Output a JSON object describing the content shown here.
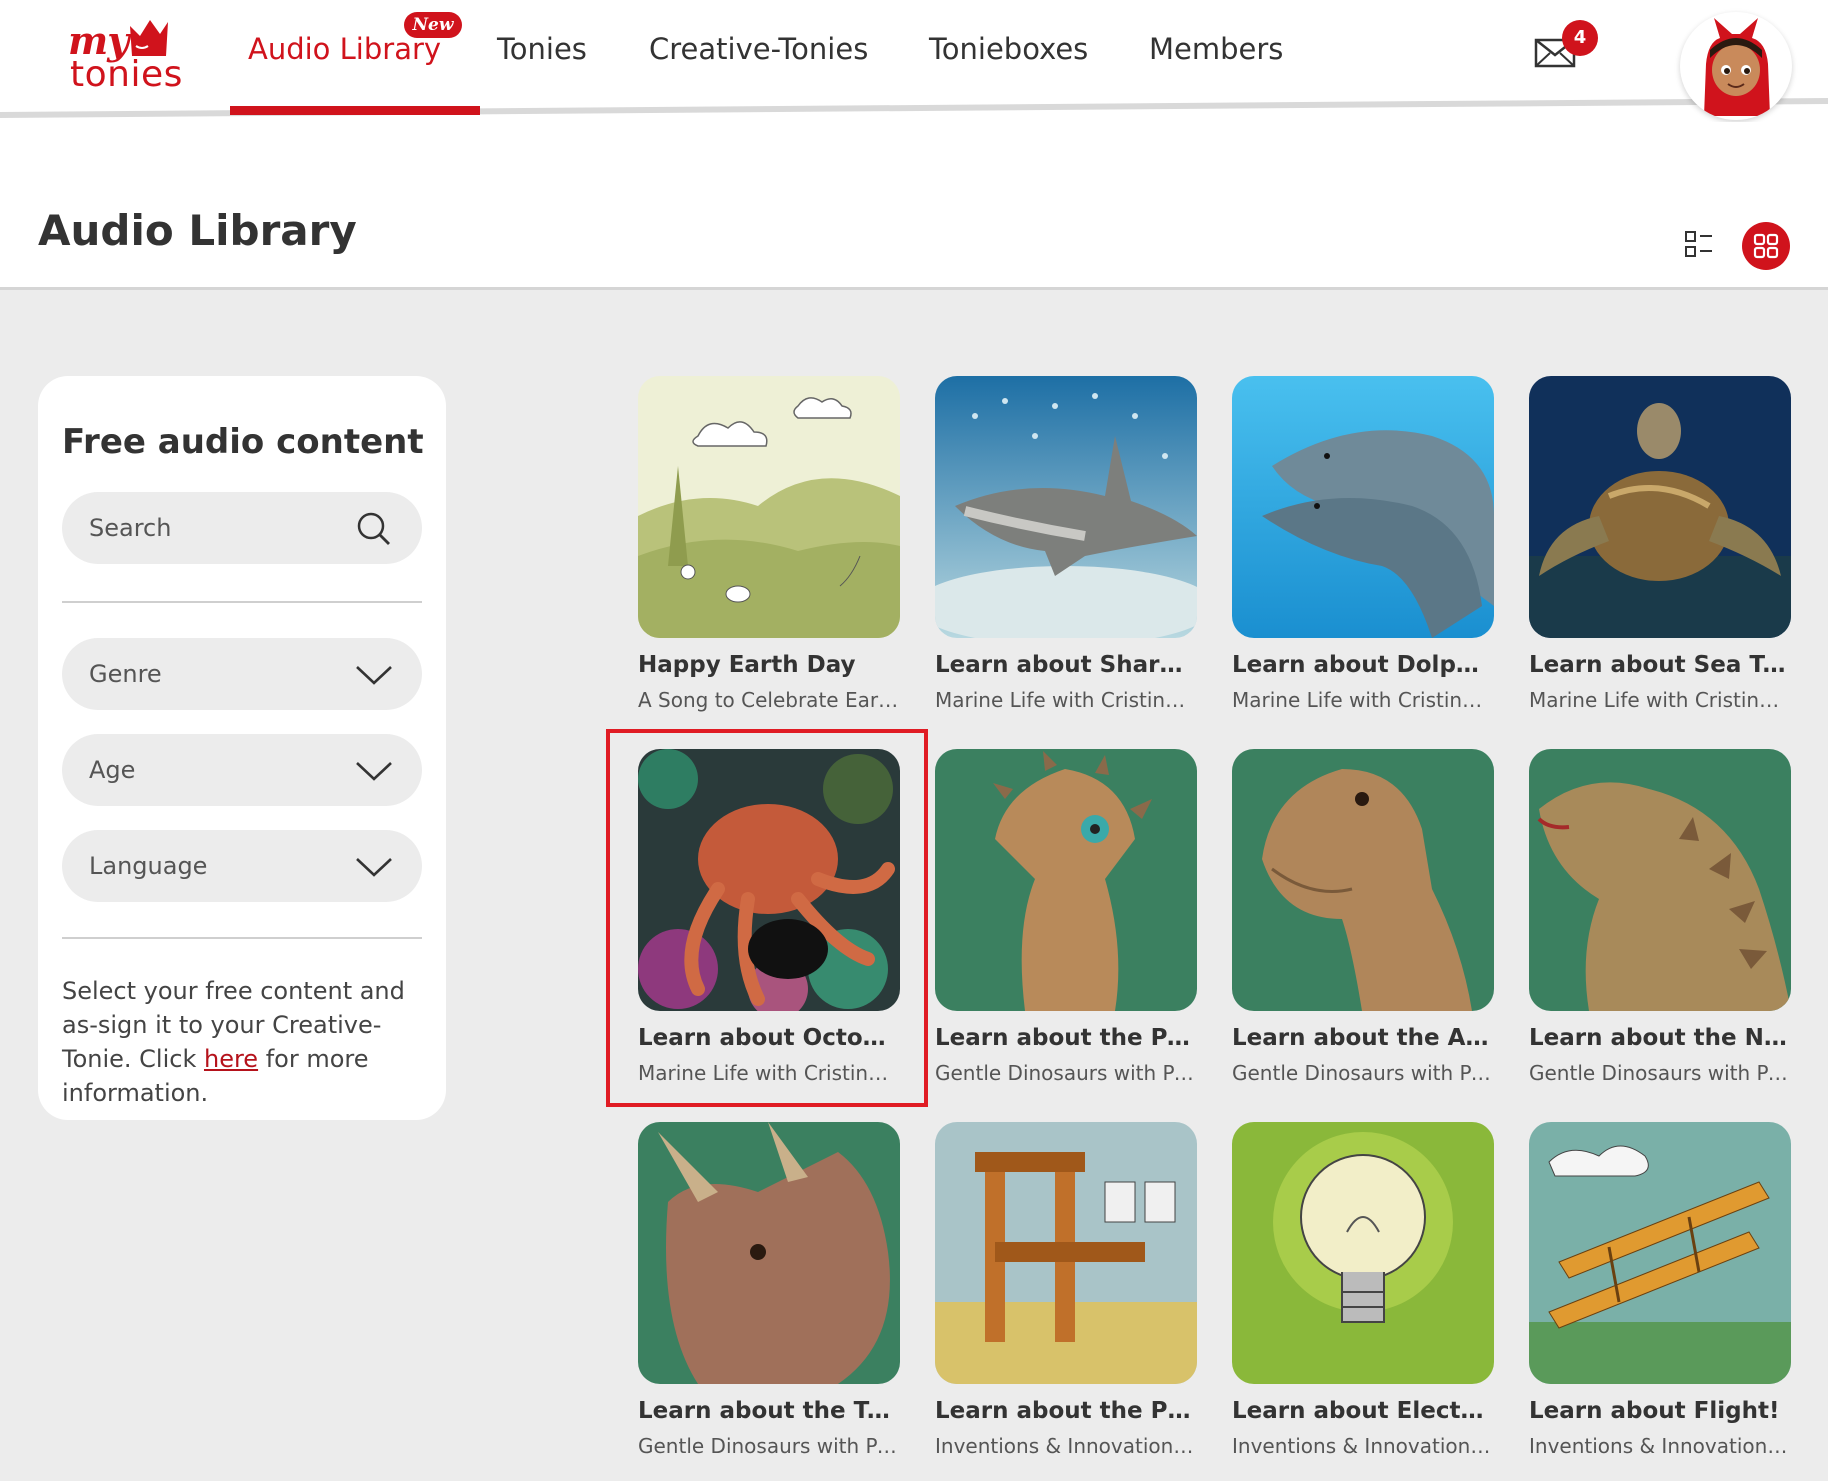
{
  "nav": {
    "logo_my": "my",
    "logo_tonies": "tonies",
    "new_badge": "New",
    "items": [
      {
        "label": "Audio Library",
        "active": true
      },
      {
        "label": "Tonies",
        "active": false
      },
      {
        "label": "Creative-Tonies",
        "active": false
      },
      {
        "label": "Tonieboxes",
        "active": false
      },
      {
        "label": "Members",
        "active": false
      }
    ],
    "mail_icon": "envelope-icon",
    "mail_count": "4",
    "avatar_icon": "red-cat-avatar-icon"
  },
  "page": {
    "title": "Audio Library",
    "view_list_icon": "list-view-icon",
    "view_grid_icon": "grid-view-icon"
  },
  "sidebar": {
    "title": "Free audio content",
    "search_placeholder": "Search",
    "search_icon": "search-icon",
    "filters": [
      {
        "label": "Genre"
      },
      {
        "label": "Age"
      },
      {
        "label": "Language"
      }
    ],
    "chevron_icon": "chevron-down-icon",
    "info_before": "Select your free content and as-sign it to your Creative-Tonie. Click ",
    "info_link": "here",
    "info_after": " for more information."
  },
  "cards": [
    {
      "title": "Happy Earth Day",
      "subtitle": "A Song to Celebrate Earth Day",
      "image": "earth-day-meadow-illustration"
    },
    {
      "title": "Learn about Sharks!",
      "subtitle": "Marine Life with Cristina Zenato",
      "image": "shark-underwater-photo"
    },
    {
      "title": "Learn about Dolphins!",
      "subtitle": "Marine Life with Cristina Zenato",
      "image": "dolphins-photo"
    },
    {
      "title": "Learn about Sea Turtles!",
      "subtitle": "Marine Life with Cristina Zenato",
      "image": "sea-turtle-photo"
    },
    {
      "title": "Learn about Octopus!",
      "subtitle": "Marine Life with Cristina Zenato",
      "image": "octopus-photo",
      "highlighted": true
    },
    {
      "title": "Learn about the Pachycephalosaurus!",
      "subtitle": "Gentle Dinosaurs with Paul",
      "image": "pachycephalosaurus-illustration"
    },
    {
      "title": "Learn about the Argentinosaurus!",
      "subtitle": "Gentle Dinosaurs with Paul",
      "image": "argentinosaurus-illustration"
    },
    {
      "title": "Learn about the Nodosaurus!",
      "subtitle": "Gentle Dinosaurs with Paul",
      "image": "nodosaurus-illustration"
    },
    {
      "title": "Learn about the Triceratops!",
      "subtitle": "Gentle Dinosaurs with Paul",
      "image": "triceratops-illustration"
    },
    {
      "title": "Learn about the Printing Press!",
      "subtitle": "Inventions & Innovation with Paul",
      "image": "printing-press-illustration"
    },
    {
      "title": "Learn about Electricity!",
      "subtitle": "Inventions & Innovation with Paul",
      "image": "light-bulb-illustration"
    },
    {
      "title": "Learn about Flight!",
      "subtitle": "Inventions & Innovation with Paul",
      "image": "biplane-illustration"
    }
  ],
  "colors": {
    "brand_red": "#d0131c",
    "page_bg": "#ececec",
    "card_bg": "#ffffff",
    "dino_green": "#3b8060"
  }
}
